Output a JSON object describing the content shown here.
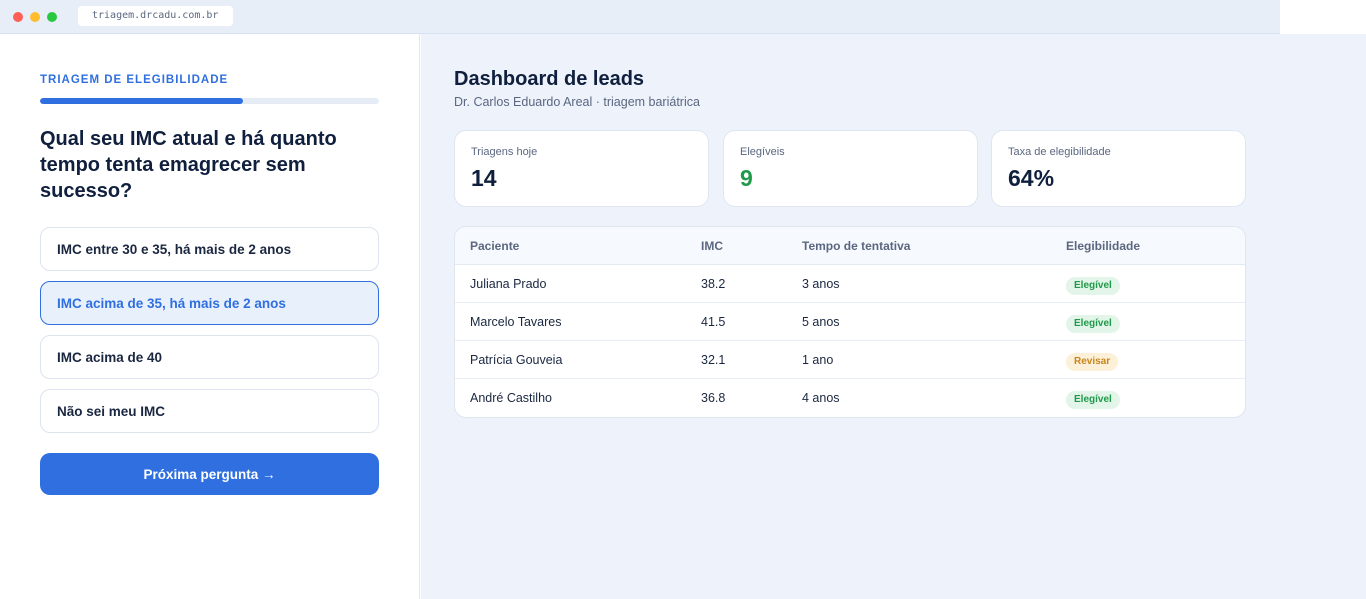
{
  "browser": {
    "url": "triagem.drcadu.com.br"
  },
  "triage": {
    "eyebrow": "TRIAGEM DE ELEGIBILIDADE",
    "progress": 0.6,
    "question": "Qual seu IMC atual e há quanto tempo tenta emagrecer sem sucesso?",
    "options": [
      {
        "label": "IMC entre 30 e 35, há mais de 2 anos",
        "selected": false
      },
      {
        "label": "IMC acima de 35, há mais de 2 anos",
        "selected": true
      },
      {
        "label": "IMC acima de 40",
        "selected": false
      },
      {
        "label": "Não sei meu IMC",
        "selected": false
      }
    ],
    "next_label": "Próxima pergunta →"
  },
  "dashboard": {
    "title": "Dashboard de leads",
    "subtitle": "Dr. Carlos Eduardo Areal · triagem bariátrica",
    "stats": [
      {
        "label": "Triagens hoje",
        "value": "14"
      },
      {
        "label": "Elegíveis",
        "value": "9"
      },
      {
        "label": "Taxa de elegibilidade",
        "value": "64%"
      }
    ],
    "table": {
      "headers": [
        "Paciente",
        "IMC",
        "Tempo de tentativa",
        "Elegibilidade"
      ],
      "rows": [
        {
          "name": "Juliana Prado",
          "imc": "38.2",
          "time": "3 anos",
          "status": "Elegível"
        },
        {
          "name": "Marcelo Tavares",
          "imc": "41.5",
          "time": "5 anos",
          "status": "Elegível"
        },
        {
          "name": "Patrícia Gouveia",
          "imc": "32.1",
          "time": "1 ano",
          "status": "Revisar"
        },
        {
          "name": "André Castilho",
          "imc": "36.8",
          "time": "4 anos",
          "status": "Elegível"
        }
      ]
    }
  },
  "colors": {
    "accent": "#2f6fe0",
    "success": "#1f9a4a",
    "warning": "#c9851a"
  }
}
